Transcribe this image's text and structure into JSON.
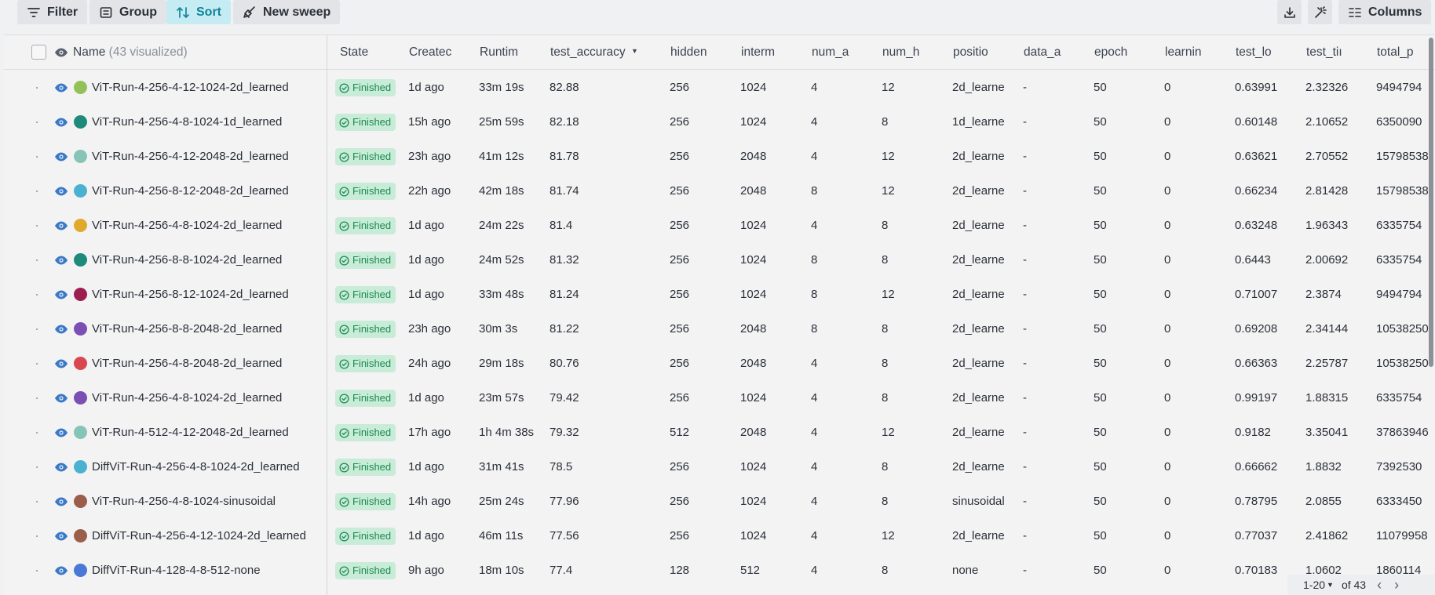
{
  "toolbar": {
    "filter_label": "Filter",
    "group_label": "Group",
    "sort_label": "Sort",
    "new_sweep_label": "New sweep",
    "columns_label": "Columns"
  },
  "table": {
    "name_header": "Name",
    "visualized_count": "(43 visualized)",
    "columns": [
      "State",
      "Createc",
      "Runtim",
      "test_accuracy",
      "hidden",
      "interm",
      "num_a",
      "num_h",
      "positio",
      "data_a",
      "epoch",
      "learnin",
      "test_lo",
      "test_tiı",
      "total_p"
    ],
    "rows": [
      {
        "name": "ViT-Run-4-256-4-12-1024-2d_learned",
        "color": "#93c157",
        "state": "Finished",
        "created": "1d ago",
        "runtime": "33m 19s",
        "test_accuracy": "82.88",
        "hidden": "256",
        "interm": "1024",
        "num_a": "4",
        "num_h": "12",
        "positio": "2d_learne",
        "data_a": "-",
        "epoch": "50",
        "learnin": "0",
        "test_lo": "0.63991",
        "test_ti": "2.32326",
        "total_p": "9494794"
      },
      {
        "name": "ViT-Run-4-256-4-8-1024-1d_learned",
        "color": "#1d8a7a",
        "state": "Finished",
        "created": "15h ago",
        "runtime": "25m 59s",
        "test_accuracy": "82.18",
        "hidden": "256",
        "interm": "1024",
        "num_a": "4",
        "num_h": "8",
        "positio": "1d_learne",
        "data_a": "-",
        "epoch": "50",
        "learnin": "0",
        "test_lo": "0.60148",
        "test_ti": "2.10652",
        "total_p": "6350090"
      },
      {
        "name": "ViT-Run-4-256-4-12-2048-2d_learned",
        "color": "#87c4b8",
        "state": "Finished",
        "created": "23h ago",
        "runtime": "41m 12s",
        "test_accuracy": "81.78",
        "hidden": "256",
        "interm": "2048",
        "num_a": "4",
        "num_h": "12",
        "positio": "2d_learne",
        "data_a": "-",
        "epoch": "50",
        "learnin": "0",
        "test_lo": "0.63621",
        "test_ti": "2.70552",
        "total_p": "15798538"
      },
      {
        "name": "ViT-Run-4-256-8-12-2048-2d_learned",
        "color": "#4bb1d1",
        "state": "Finished",
        "created": "22h ago",
        "runtime": "42m 18s",
        "test_accuracy": "81.74",
        "hidden": "256",
        "interm": "2048",
        "num_a": "8",
        "num_h": "12",
        "positio": "2d_learne",
        "data_a": "-",
        "epoch": "50",
        "learnin": "0",
        "test_lo": "0.66234",
        "test_ti": "2.81428",
        "total_p": "15798538"
      },
      {
        "name": "ViT-Run-4-256-4-8-1024-2d_learned",
        "color": "#e0a92c",
        "state": "Finished",
        "created": "1d ago",
        "runtime": "24m 22s",
        "test_accuracy": "81.4",
        "hidden": "256",
        "interm": "1024",
        "num_a": "4",
        "num_h": "8",
        "positio": "2d_learne",
        "data_a": "-",
        "epoch": "50",
        "learnin": "0",
        "test_lo": "0.63248",
        "test_ti": "1.96343",
        "total_p": "6335754"
      },
      {
        "name": "ViT-Run-4-256-8-8-1024-2d_learned",
        "color": "#1d8a7a",
        "state": "Finished",
        "created": "1d ago",
        "runtime": "24m 52s",
        "test_accuracy": "81.32",
        "hidden": "256",
        "interm": "1024",
        "num_a": "8",
        "num_h": "8",
        "positio": "2d_learne",
        "data_a": "-",
        "epoch": "50",
        "learnin": "0",
        "test_lo": "0.6443",
        "test_ti": "2.00692",
        "total_p": "6335754"
      },
      {
        "name": "ViT-Run-4-256-8-12-1024-2d_learned",
        "color": "#9c1f4f",
        "state": "Finished",
        "created": "1d ago",
        "runtime": "33m 48s",
        "test_accuracy": "81.24",
        "hidden": "256",
        "interm": "1024",
        "num_a": "8",
        "num_h": "12",
        "positio": "2d_learne",
        "data_a": "-",
        "epoch": "50",
        "learnin": "0",
        "test_lo": "0.71007",
        "test_ti": "2.3874",
        "total_p": "9494794"
      },
      {
        "name": "ViT-Run-4-256-8-8-2048-2d_learned",
        "color": "#7b4fb3",
        "state": "Finished",
        "created": "23h ago",
        "runtime": "30m 3s",
        "test_accuracy": "81.22",
        "hidden": "256",
        "interm": "2048",
        "num_a": "8",
        "num_h": "8",
        "positio": "2d_learne",
        "data_a": "-",
        "epoch": "50",
        "learnin": "0",
        "test_lo": "0.69208",
        "test_ti": "2.34144",
        "total_p": "10538250"
      },
      {
        "name": "ViT-Run-4-256-4-8-2048-2d_learned",
        "color": "#d9474f",
        "state": "Finished",
        "created": "24h ago",
        "runtime": "29m 18s",
        "test_accuracy": "80.76",
        "hidden": "256",
        "interm": "2048",
        "num_a": "4",
        "num_h": "8",
        "positio": "2d_learne",
        "data_a": "-",
        "epoch": "50",
        "learnin": "0",
        "test_lo": "0.66363",
        "test_ti": "2.25787",
        "total_p": "10538250"
      },
      {
        "name": "ViT-Run-4-256-4-8-1024-2d_learned",
        "color": "#7b4fb3",
        "state": "Finished",
        "created": "1d ago",
        "runtime": "23m 57s",
        "test_accuracy": "79.42",
        "hidden": "256",
        "interm": "1024",
        "num_a": "4",
        "num_h": "8",
        "positio": "2d_learne",
        "data_a": "-",
        "epoch": "50",
        "learnin": "0",
        "test_lo": "0.99197",
        "test_ti": "1.88315",
        "total_p": "6335754"
      },
      {
        "name": "ViT-Run-4-512-4-12-2048-2d_learned",
        "color": "#87c4b8",
        "state": "Finished",
        "created": "17h ago",
        "runtime": "1h 4m 38s",
        "test_accuracy": "79.32",
        "hidden": "512",
        "interm": "2048",
        "num_a": "4",
        "num_h": "12",
        "positio": "2d_learne",
        "data_a": "-",
        "epoch": "50",
        "learnin": "0",
        "test_lo": "0.9182",
        "test_ti": "3.35041",
        "total_p": "37863946"
      },
      {
        "name": "DiffViT-Run-4-256-4-8-1024-2d_learned",
        "color": "#4bb1d1",
        "state": "Finished",
        "created": "1d ago",
        "runtime": "31m 41s",
        "test_accuracy": "78.5",
        "hidden": "256",
        "interm": "1024",
        "num_a": "4",
        "num_h": "8",
        "positio": "2d_learne",
        "data_a": "-",
        "epoch": "50",
        "learnin": "0",
        "test_lo": "0.66662",
        "test_ti": "1.8832",
        "total_p": "7392530"
      },
      {
        "name": "ViT-Run-4-256-4-8-1024-sinusoidal",
        "color": "#9b5e4a",
        "state": "Finished",
        "created": "14h ago",
        "runtime": "25m 24s",
        "test_accuracy": "77.96",
        "hidden": "256",
        "interm": "1024",
        "num_a": "4",
        "num_h": "8",
        "positio": "sinusoidal",
        "data_a": "-",
        "epoch": "50",
        "learnin": "0",
        "test_lo": "0.78795",
        "test_ti": "2.0855",
        "total_p": "6333450"
      },
      {
        "name": "DiffViT-Run-4-256-4-12-1024-2d_learned",
        "color": "#9b5e4a",
        "state": "Finished",
        "created": "1d ago",
        "runtime": "46m 11s",
        "test_accuracy": "77.56",
        "hidden": "256",
        "interm": "1024",
        "num_a": "4",
        "num_h": "12",
        "positio": "2d_learne",
        "data_a": "-",
        "epoch": "50",
        "learnin": "0",
        "test_lo": "0.77037",
        "test_ti": "2.41862",
        "total_p": "11079958"
      },
      {
        "name": "DiffViT-Run-4-128-4-8-512-none",
        "color": "#4a78d6",
        "state": "Finished",
        "created": "9h ago",
        "runtime": "18m 10s",
        "test_accuracy": "77.4",
        "hidden": "128",
        "interm": "512",
        "num_a": "4",
        "num_h": "8",
        "positio": "none",
        "data_a": "-",
        "epoch": "50",
        "learnin": "0",
        "test_lo": "0.70183",
        "test_ti": "1.0602",
        "total_p": "1860114"
      }
    ]
  },
  "pagination": {
    "range": "1-20",
    "of_total": "of 43"
  }
}
